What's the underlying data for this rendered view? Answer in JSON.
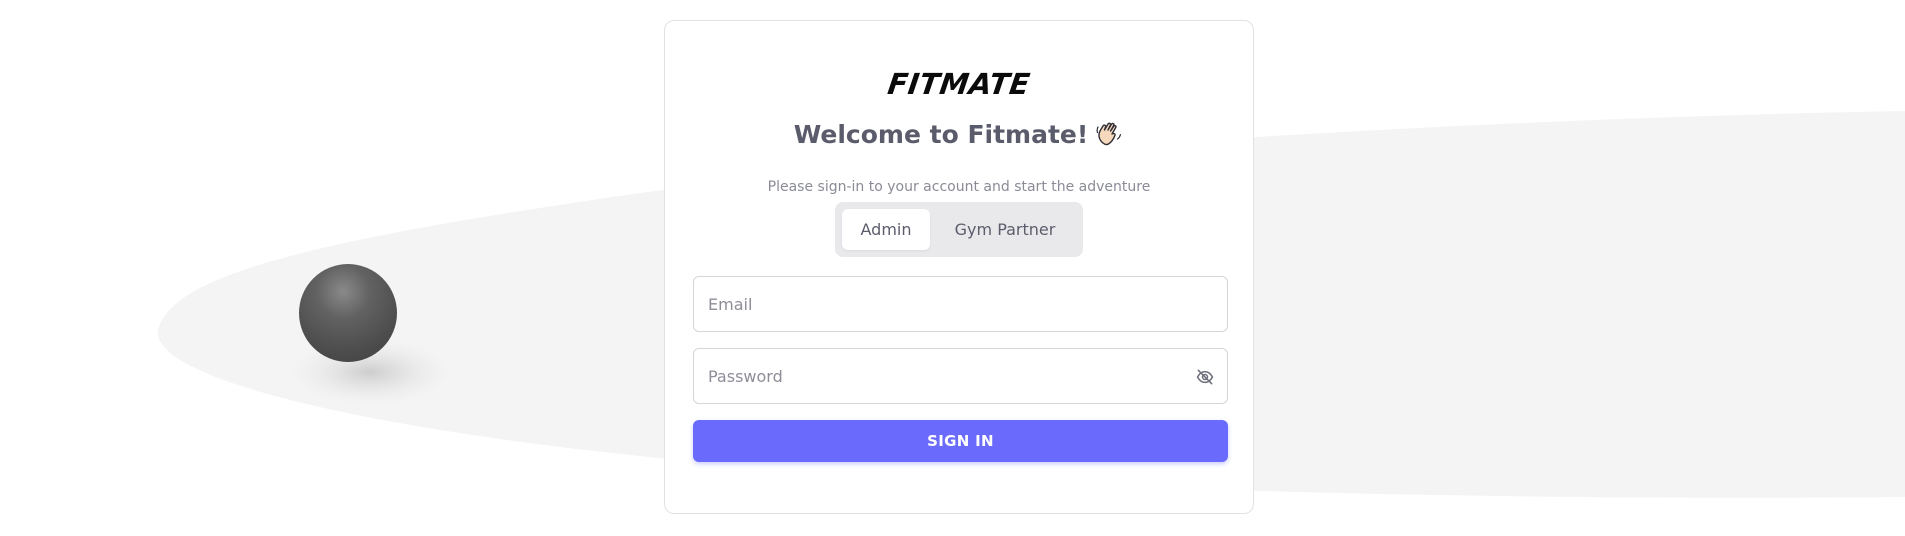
{
  "brand": {
    "logo": "FITMATE"
  },
  "heading": {
    "welcome": "Welcome to Fitmate!",
    "subtitle": "Please sign-in to your account and start the adventure",
    "emoji_icon": "waving-hand-icon"
  },
  "role_toggle": {
    "options": [
      {
        "label": "Admin",
        "selected": true
      },
      {
        "label": "Gym Partner",
        "selected": false
      }
    ]
  },
  "form": {
    "email": {
      "value": "",
      "placeholder": "Email"
    },
    "password": {
      "value": "",
      "placeholder": "Password",
      "toggle_icon": "eye-off-icon"
    },
    "submit_label": "SIGN IN"
  },
  "colors": {
    "primary": "#6a6bfc",
    "backdrop_shape": "#f4f4f4",
    "ball": "#555555"
  }
}
